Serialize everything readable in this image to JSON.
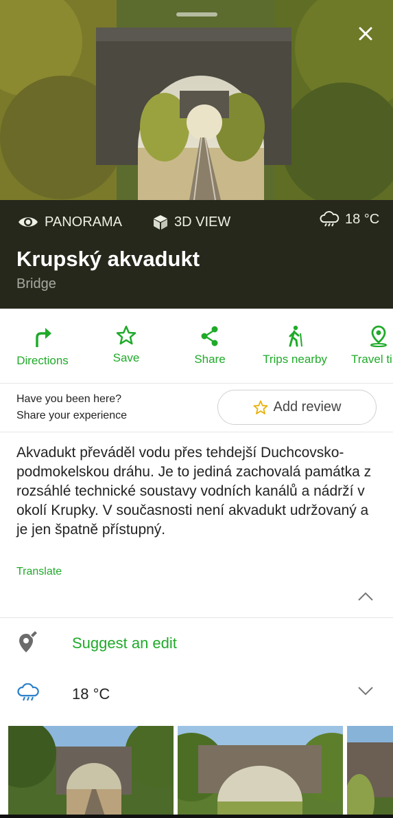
{
  "hero": {
    "image": "railway-under-stone-arch-bridge"
  },
  "view_bar": {
    "panorama_label": "PANORAMA",
    "view3d_label": "3D VIEW",
    "weather_temp": "18 °C"
  },
  "place": {
    "name": "Krupský akvadukt",
    "category": "Bridge"
  },
  "actions": [
    {
      "label": "Directions",
      "icon": "directions-icon"
    },
    {
      "label": "Save",
      "icon": "star-icon"
    },
    {
      "label": "Share",
      "icon": "share-icon"
    },
    {
      "label": "Trips nearby",
      "icon": "hiker-icon"
    },
    {
      "label": "Travel ti",
      "icon": "location-pin-icon"
    }
  ],
  "review": {
    "question": "Have you been here?",
    "prompt": "Share your experience",
    "button_label": "Add review"
  },
  "description": {
    "text": "Akvadukt převáděl vodu přes tehdejší Duchcovsko-podmokelskou dráhu. Je to jediná zachovalá památka z rozsáhlé technické soustavy vodních kanálů a nádrží v okolí Krupky. V současnosti není akvadukt udržovaný a je jen špatně přístupný.",
    "translate_label": "Translate"
  },
  "suggest_edit_label": "Suggest an edit",
  "weather_row": {
    "temp": "18 °C"
  },
  "colors": {
    "accent": "#1faa29",
    "dark_panel": "#27281c"
  }
}
